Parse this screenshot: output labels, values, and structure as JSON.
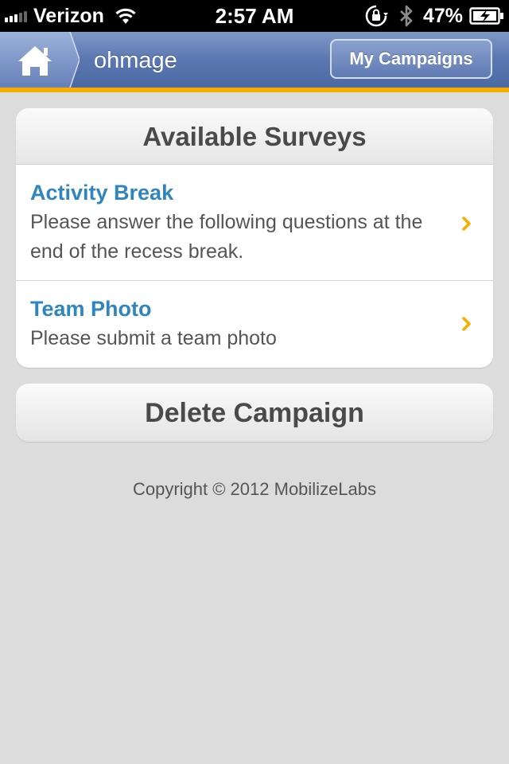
{
  "status_bar": {
    "carrier": "Verizon",
    "time": "2:57 AM",
    "battery_percent": "47%",
    "signal_bars": 3,
    "signal_bars_total": 5
  },
  "nav": {
    "app_title": "ohmage",
    "my_campaigns_label": "My Campaigns",
    "accent_color": "#f6ae00",
    "bar_color": "#5a77b1"
  },
  "surveys": {
    "header": "Available Surveys",
    "items": [
      {
        "title": "Activity Break",
        "description": "Please answer the following questions at the end of the recess break."
      },
      {
        "title": "Team Photo",
        "description": "Please submit a team photo"
      }
    ],
    "title_color": "#2f86bf",
    "chevron_color": "#f6ae00"
  },
  "actions": {
    "delete_label": "Delete Campaign"
  },
  "footer": {
    "copyright": "Copyright © 2012 MobilizeLabs"
  },
  "icons": {
    "home": "home-icon",
    "wifi": "wifi-icon",
    "rotation_lock": "rotation-lock-icon",
    "bluetooth": "bluetooth-icon",
    "battery": "battery-charging-icon",
    "chevron": "chevron-right-icon"
  }
}
